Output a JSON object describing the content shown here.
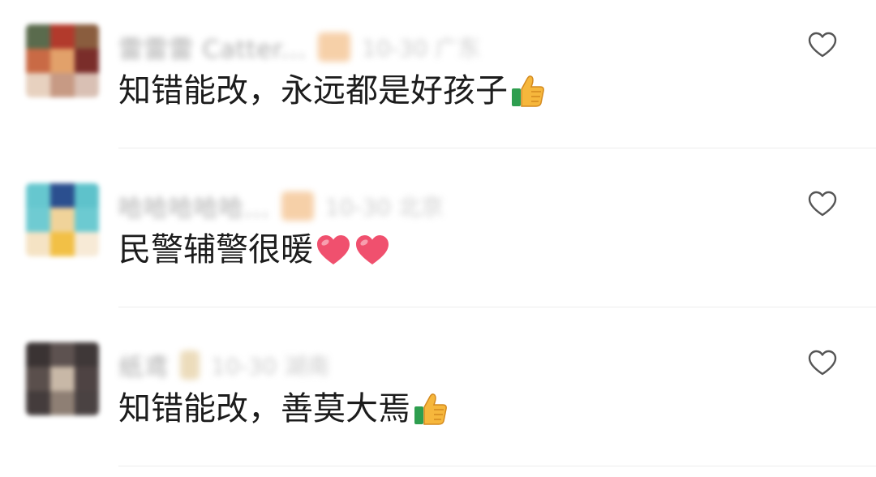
{
  "comments": [
    {
      "username": "雷雷雷 Catter...",
      "timestamp": "10-30 广东",
      "text": "知错能改，永远都是好孩子",
      "emoji": [
        "thumbs-up-icon"
      ],
      "avatar_colors": [
        "#5a6b4d",
        "#b23a2c",
        "#8a5d3e",
        "#c96a45",
        "#e2a16a",
        "#7a2d2a",
        "#e7d1bf",
        "#c79a84",
        "#d9c0b4"
      ]
    },
    {
      "username": "哈哈哈哈哈...",
      "timestamp": "10-30 北京",
      "text": "民警辅警很暖",
      "emoji": [
        "heart-icon",
        "heart-icon"
      ],
      "avatar_colors": [
        "#66c7cf",
        "#2b4f8f",
        "#5ec2cb",
        "#6fcbd2",
        "#f0d39a",
        "#6ccad1",
        "#f5e3c4",
        "#f2c046",
        "#f7ead6"
      ]
    },
    {
      "username": "纸鸢",
      "timestamp": "10-30 湖南",
      "text": "知错能改，善莫大焉",
      "emoji": [
        "thumbs-up-icon"
      ],
      "avatar_colors": [
        "#3a3333",
        "#5d5250",
        "#3f3838",
        "#5a4f4c",
        "#c8b8a7",
        "#4e4343",
        "#443c3c",
        "#8e7f74",
        "#4a4242"
      ]
    }
  ],
  "colors": {
    "text": "#1c1c1c",
    "meta": "#9a9a9a",
    "divider": "#ececec",
    "like_icon": "#555555"
  }
}
